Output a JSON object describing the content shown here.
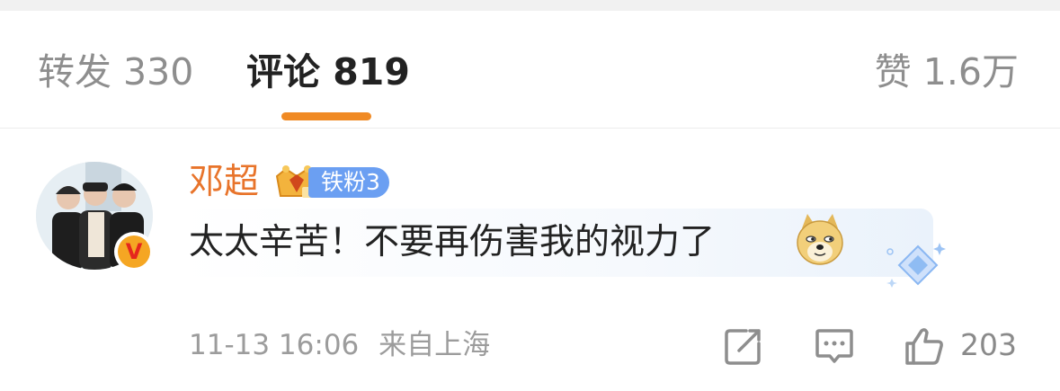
{
  "tabs": {
    "repost": "转发 330",
    "comments": "评论 819",
    "likes": "赞 1.6万",
    "active_color": "#f08a24"
  },
  "comment": {
    "username": "邓超",
    "fan_badge": "铁粉3",
    "text": "太太辛苦！不要再伤害我的视力了",
    "emoji": "doge-emoji",
    "timestamp": "11-13 16:06",
    "location": "来自上海",
    "like_count": "203",
    "username_color": "#e8742b"
  },
  "icons": {
    "share": "share-icon",
    "comment": "comment-icon",
    "like": "like-icon"
  }
}
